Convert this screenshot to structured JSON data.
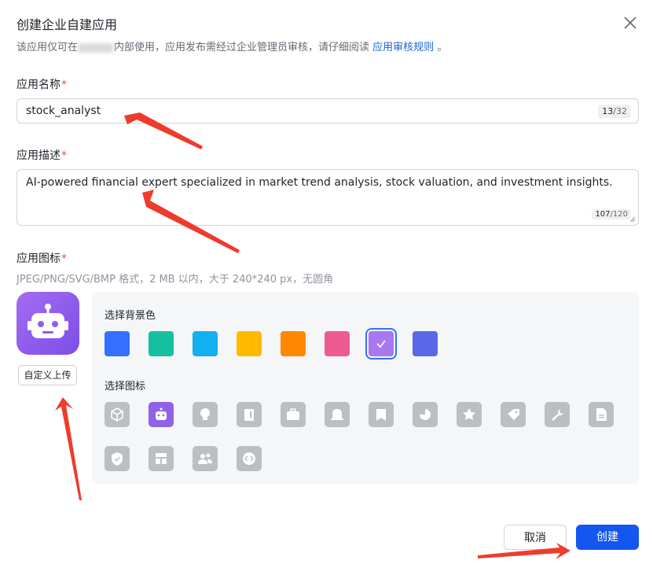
{
  "dialog": {
    "title": "创建企业自建应用",
    "desc_prefix": "该应用仅可在",
    "desc_middle": "内部使用，应用发布需经过企业管理员审核，请仔细阅读",
    "desc_link": "应用审核规则",
    "desc_suffix": "。"
  },
  "name_field": {
    "label": "应用名称",
    "required_mark": "*",
    "value": "stock_analyst",
    "count": "13",
    "max": "/32"
  },
  "desc_field": {
    "label": "应用描述",
    "required_mark": "*",
    "value": "AI-powered financial expert specialized in market trend analysis, stock valuation, and investment insights.",
    "count": "107",
    "max": "/120"
  },
  "icon_field": {
    "label": "应用图标",
    "required_mark": "*",
    "hint": "JPEG/PNG/SVG/BMP 格式，2 MB 以内，大于 240*240 px，无圆角",
    "upload_label": "自定义上传",
    "bg_label": "选择背景色",
    "icon_label": "选择图标",
    "colors": [
      "#3370ff",
      "#14c0a0",
      "#12b0f0",
      "#ffba00",
      "#ff8800",
      "#ee5a92",
      "#a878f0",
      "#5a68e8"
    ],
    "selected_color_index": 6,
    "icons": [
      "cube-icon",
      "robot-icon",
      "lightbulb-icon",
      "book-icon",
      "briefcase-icon",
      "bell-icon",
      "bookmark-icon",
      "pie-chart-icon",
      "star-badge-icon",
      "tag-icon",
      "wrench-icon",
      "document-icon",
      "shield-check-icon",
      "layout-icon",
      "people-icon",
      "code-icon"
    ],
    "selected_icon_index": 1
  },
  "footer": {
    "cancel_label": "取消",
    "create_label": "创建"
  }
}
